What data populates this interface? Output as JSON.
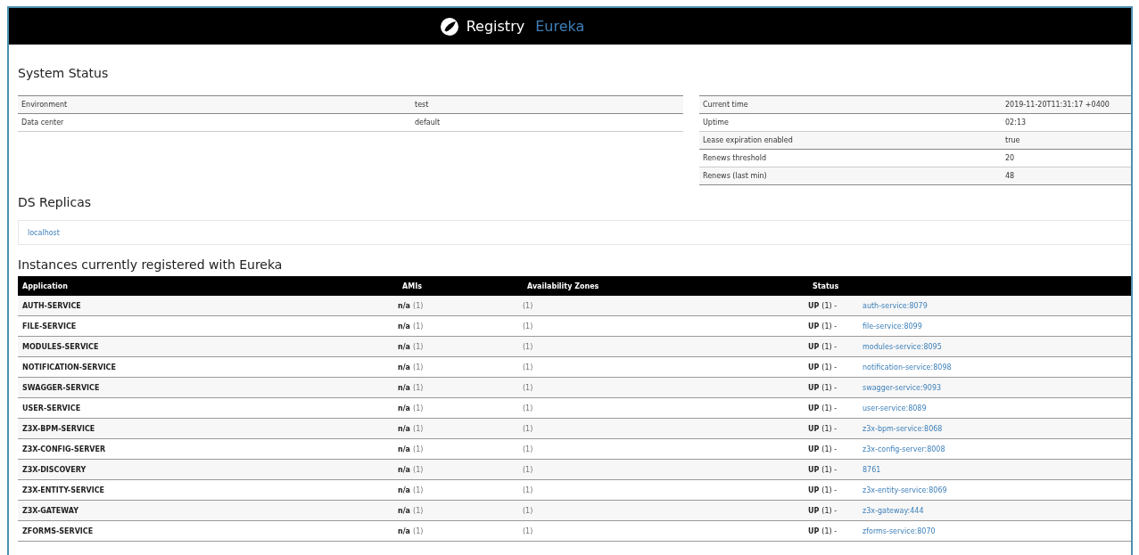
{
  "header": {
    "brand": "Registry",
    "product": "Eureka"
  },
  "system_status": {
    "title": "System Status",
    "left": [
      {
        "label": "Environment",
        "value": "test"
      },
      {
        "label": "Data center",
        "value": "default"
      }
    ],
    "right": [
      {
        "label": "Current time",
        "value": "2019-11-20T11:31:17 +0400"
      },
      {
        "label": "Uptime",
        "value": "02:13"
      },
      {
        "label": "Lease expiration enabled",
        "value": "true"
      },
      {
        "label": "Renews threshold",
        "value": "20"
      },
      {
        "label": "Renews (last min)",
        "value": "48"
      }
    ]
  },
  "ds_replicas": {
    "title": "DS Replicas",
    "items": [
      "localhost"
    ]
  },
  "instances": {
    "title": "Instances currently registered with Eureka",
    "columns": [
      "Application",
      "AMIs",
      "Availability Zones",
      "Status"
    ],
    "rows": [
      {
        "application": "AUTH-SERVICE",
        "ami": "n/a",
        "ami_count": "(1)",
        "zones": "(1)",
        "status": "UP",
        "status_count": "(1) -",
        "instance": "auth-service:8079"
      },
      {
        "application": "FILE-SERVICE",
        "ami": "n/a",
        "ami_count": "(1)",
        "zones": "(1)",
        "status": "UP",
        "status_count": "(1) -",
        "instance": "file-service:8099"
      },
      {
        "application": "MODULES-SERVICE",
        "ami": "n/a",
        "ami_count": "(1)",
        "zones": "(1)",
        "status": "UP",
        "status_count": "(1) -",
        "instance": "modules-service:8095"
      },
      {
        "application": "NOTIFICATION-SERVICE",
        "ami": "n/a",
        "ami_count": "(1)",
        "zones": "(1)",
        "status": "UP",
        "status_count": "(1) -",
        "instance": "notification-service:8098"
      },
      {
        "application": "SWAGGER-SERVICE",
        "ami": "n/a",
        "ami_count": "(1)",
        "zones": "(1)",
        "status": "UP",
        "status_count": "(1) -",
        "instance": "swagger-service:9093"
      },
      {
        "application": "USER-SERVICE",
        "ami": "n/a",
        "ami_count": "(1)",
        "zones": "(1)",
        "status": "UP",
        "status_count": "(1) -",
        "instance": "user-service:8089"
      },
      {
        "application": "Z3X-BPM-SERVICE",
        "ami": "n/a",
        "ami_count": "(1)",
        "zones": "(1)",
        "status": "UP",
        "status_count": "(1) -",
        "instance": "z3x-bpm-service:8068"
      },
      {
        "application": "Z3X-CONFIG-SERVER",
        "ami": "n/a",
        "ami_count": "(1)",
        "zones": "(1)",
        "status": "UP",
        "status_count": "(1) -",
        "instance": "z3x-config-server:8008"
      },
      {
        "application": "Z3X-DISCOVERY",
        "ami": "n/a",
        "ami_count": "(1)",
        "zones": "(1)",
        "status": "UP",
        "status_count": "(1) -",
        "instance": "8761"
      },
      {
        "application": "Z3X-ENTITY-SERVICE",
        "ami": "n/a",
        "ami_count": "(1)",
        "zones": "(1)",
        "status": "UP",
        "status_count": "(1) -",
        "instance": "z3x-entity-service:8069"
      },
      {
        "application": "Z3X-GATEWAY",
        "ami": "n/a",
        "ami_count": "(1)",
        "zones": "(1)",
        "status": "UP",
        "status_count": "(1) -",
        "instance": "z3x-gateway:444"
      },
      {
        "application": "ZFORMS-SERVICE",
        "ami": "n/a",
        "ami_count": "(1)",
        "zones": "(1)",
        "status": "UP",
        "status_count": "(1) -",
        "instance": "zforms-service:8070"
      }
    ]
  }
}
